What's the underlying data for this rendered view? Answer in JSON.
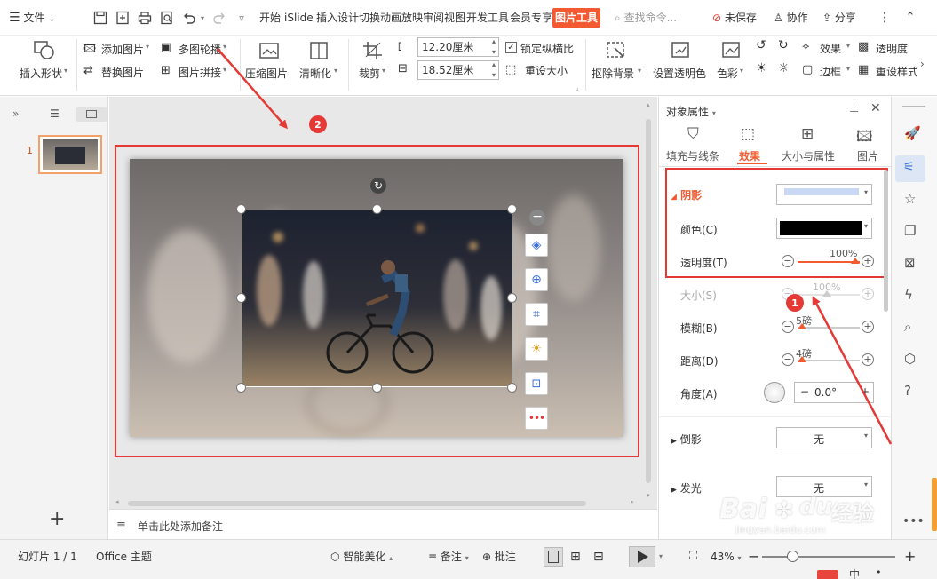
{
  "titlebar": {
    "menu_label": "文件",
    "tabs": [
      "开始",
      "iSlide",
      "插入",
      "设计",
      "切换",
      "动画",
      "放映",
      "审阅",
      "视图",
      "开发工具",
      "会员专享"
    ],
    "active_tab": "图片工具",
    "search_placeholder": "查找命令...",
    "unsaved_label": "未保存",
    "collab_label": "协作",
    "share_label": "分享"
  },
  "ribbon": {
    "insert_shape": "插入形状",
    "add_image": "添加图片",
    "multi_carousel": "多图轮播",
    "replace_image": "替换图片",
    "image_collage": "图片拼接",
    "compress": "压缩图片",
    "sharpen": "清晰化",
    "crop": "裁剪",
    "height_value": "12.20厘米",
    "width_value": "18.52厘米",
    "lock_ratio": "锁定纵横比",
    "reset_size": "重设大小",
    "remove_bg": "抠除背景",
    "set_transparent": "设置透明色",
    "color": "色彩",
    "effects": "效果",
    "border": "边框",
    "transparency": "透明度",
    "reset_style": "重设样式"
  },
  "leftpanel": {
    "slide_number": "1",
    "add_icon": "plus-icon"
  },
  "canvas": {
    "annotation_2": "2"
  },
  "rpanel": {
    "title": "对象属性",
    "tabs": [
      "填充与线条",
      "效果",
      "大小与属性",
      "图片"
    ],
    "active_tab": "效果",
    "shadow_label": "阴影",
    "color_label": "颜色(C)",
    "transparency_label": "透明度(T)",
    "transparency_value": "100%",
    "size_label": "大小(S)",
    "size_value": "100%",
    "blur_label": "模糊(B)",
    "blur_value": "5磅",
    "distance_label": "距离(D)",
    "distance_value": "4磅",
    "angle_label": "角度(A)",
    "angle_value": "0.0°",
    "reflection_label": "倒影",
    "reflection_value": "无",
    "glow_label": "发光",
    "glow_value": "无",
    "annotation_1": "1",
    "shadow_color": "#000000",
    "preset_color": "#c9d9f5"
  },
  "notes": {
    "placeholder": "单击此处添加备注"
  },
  "statusbar": {
    "slide_info": "幻灯片 1 / 1",
    "theme": "Office 主题",
    "smart_beautify": "智能美化",
    "notes": "备注",
    "comment": "批注",
    "zoom": "43%"
  },
  "watermark": {
    "brand": "Bai",
    "brand2": "经验",
    "url": "jingyan.baidu.com"
  },
  "accent_color": "#f45a32",
  "annotation_color": "#e53935"
}
